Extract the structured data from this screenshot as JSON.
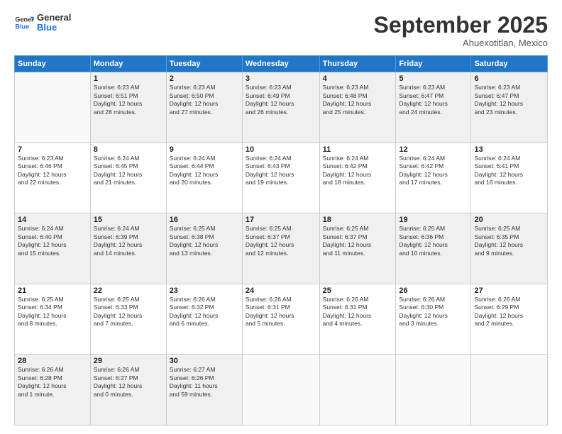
{
  "header": {
    "logo_general": "General",
    "logo_blue": "Blue",
    "month": "September 2025",
    "location": "Ahuexotitlan, Mexico"
  },
  "days_of_week": [
    "Sunday",
    "Monday",
    "Tuesday",
    "Wednesday",
    "Thursday",
    "Friday",
    "Saturday"
  ],
  "weeks": [
    [
      {
        "day": "",
        "info": ""
      },
      {
        "day": "1",
        "info": "Sunrise: 6:23 AM\nSunset: 6:51 PM\nDaylight: 12 hours\nand 28 minutes."
      },
      {
        "day": "2",
        "info": "Sunrise: 6:23 AM\nSunset: 6:50 PM\nDaylight: 12 hours\nand 27 minutes."
      },
      {
        "day": "3",
        "info": "Sunrise: 6:23 AM\nSunset: 6:49 PM\nDaylight: 12 hours\nand 26 minutes."
      },
      {
        "day": "4",
        "info": "Sunrise: 6:23 AM\nSunset: 6:48 PM\nDaylight: 12 hours\nand 25 minutes."
      },
      {
        "day": "5",
        "info": "Sunrise: 6:23 AM\nSunset: 6:47 PM\nDaylight: 12 hours\nand 24 minutes."
      },
      {
        "day": "6",
        "info": "Sunrise: 6:23 AM\nSunset: 6:47 PM\nDaylight: 12 hours\nand 23 minutes."
      }
    ],
    [
      {
        "day": "7",
        "info": "Sunrise: 6:23 AM\nSunset: 6:46 PM\nDaylight: 12 hours\nand 22 minutes."
      },
      {
        "day": "8",
        "info": "Sunrise: 6:24 AM\nSunset: 6:45 PM\nDaylight: 12 hours\nand 21 minutes."
      },
      {
        "day": "9",
        "info": "Sunrise: 6:24 AM\nSunset: 6:44 PM\nDaylight: 12 hours\nand 20 minutes."
      },
      {
        "day": "10",
        "info": "Sunrise: 6:24 AM\nSunset: 6:43 PM\nDaylight: 12 hours\nand 19 minutes."
      },
      {
        "day": "11",
        "info": "Sunrise: 6:24 AM\nSunset: 6:42 PM\nDaylight: 12 hours\nand 18 minutes."
      },
      {
        "day": "12",
        "info": "Sunrise: 6:24 AM\nSunset: 6:42 PM\nDaylight: 12 hours\nand 17 minutes."
      },
      {
        "day": "13",
        "info": "Sunrise: 6:24 AM\nSunset: 6:41 PM\nDaylight: 12 hours\nand 16 minutes."
      }
    ],
    [
      {
        "day": "14",
        "info": "Sunrise: 6:24 AM\nSunset: 6:40 PM\nDaylight: 12 hours\nand 15 minutes."
      },
      {
        "day": "15",
        "info": "Sunrise: 6:24 AM\nSunset: 6:39 PM\nDaylight: 12 hours\nand 14 minutes."
      },
      {
        "day": "16",
        "info": "Sunrise: 6:25 AM\nSunset: 6:38 PM\nDaylight: 12 hours\nand 13 minutes."
      },
      {
        "day": "17",
        "info": "Sunrise: 6:25 AM\nSunset: 6:37 PM\nDaylight: 12 hours\nand 12 minutes."
      },
      {
        "day": "18",
        "info": "Sunrise: 6:25 AM\nSunset: 6:37 PM\nDaylight: 12 hours\nand 11 minutes."
      },
      {
        "day": "19",
        "info": "Sunrise: 6:25 AM\nSunset: 6:36 PM\nDaylight: 12 hours\nand 10 minutes."
      },
      {
        "day": "20",
        "info": "Sunrise: 6:25 AM\nSunset: 6:35 PM\nDaylight: 12 hours\nand 9 minutes."
      }
    ],
    [
      {
        "day": "21",
        "info": "Sunrise: 6:25 AM\nSunset: 6:34 PM\nDaylight: 12 hours\nand 8 minutes."
      },
      {
        "day": "22",
        "info": "Sunrise: 6:25 AM\nSunset: 6:33 PM\nDaylight: 12 hours\nand 7 minutes."
      },
      {
        "day": "23",
        "info": "Sunrise: 6:26 AM\nSunset: 6:32 PM\nDaylight: 12 hours\nand 6 minutes."
      },
      {
        "day": "24",
        "info": "Sunrise: 6:26 AM\nSunset: 6:31 PM\nDaylight: 12 hours\nand 5 minutes."
      },
      {
        "day": "25",
        "info": "Sunrise: 6:26 AM\nSunset: 6:31 PM\nDaylight: 12 hours\nand 4 minutes."
      },
      {
        "day": "26",
        "info": "Sunrise: 6:26 AM\nSunset: 6:30 PM\nDaylight: 12 hours\nand 3 minutes."
      },
      {
        "day": "27",
        "info": "Sunrise: 6:26 AM\nSunset: 6:29 PM\nDaylight: 12 hours\nand 2 minutes."
      }
    ],
    [
      {
        "day": "28",
        "info": "Sunrise: 6:26 AM\nSunset: 6:28 PM\nDaylight: 12 hours\nand 1 minute."
      },
      {
        "day": "29",
        "info": "Sunrise: 6:26 AM\nSunset: 6:27 PM\nDaylight: 12 hours\nand 0 minutes."
      },
      {
        "day": "30",
        "info": "Sunrise: 6:27 AM\nSunset: 6:26 PM\nDaylight: 11 hours\nand 59 minutes."
      },
      {
        "day": "",
        "info": ""
      },
      {
        "day": "",
        "info": ""
      },
      {
        "day": "",
        "info": ""
      },
      {
        "day": "",
        "info": ""
      }
    ]
  ]
}
